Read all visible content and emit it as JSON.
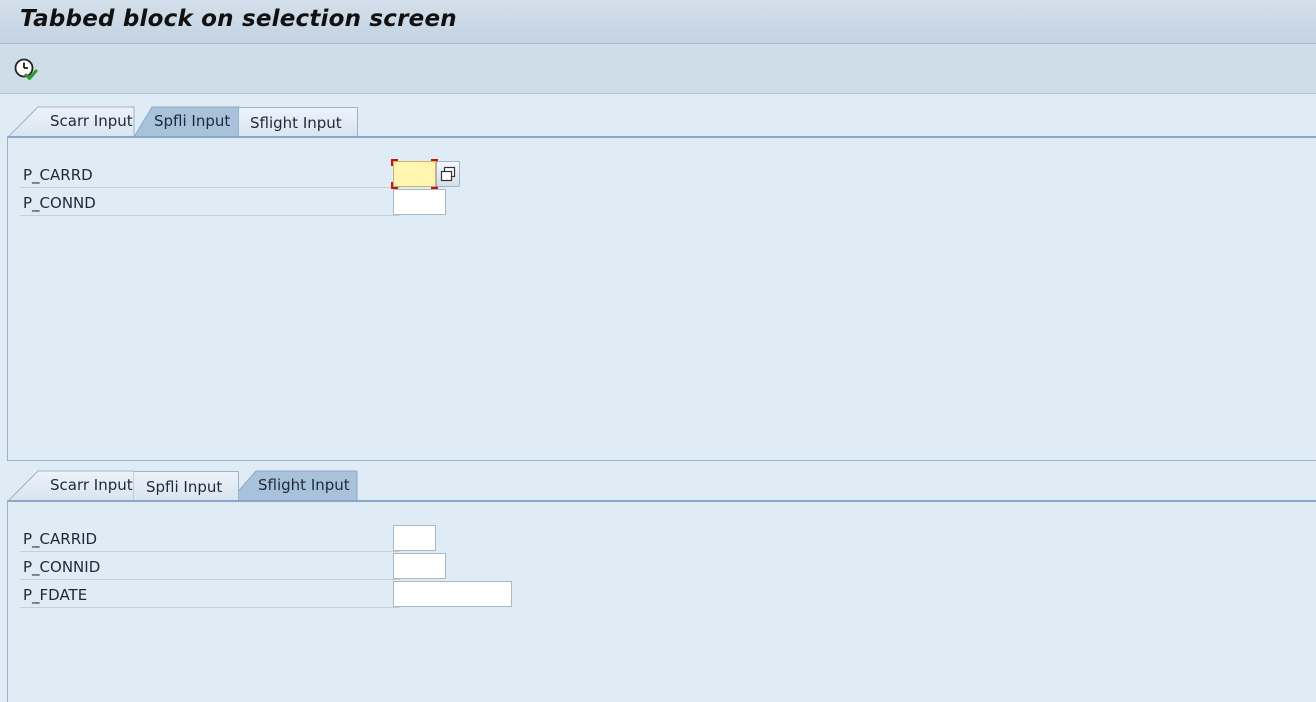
{
  "window": {
    "title": "Tabbed block on selection screen"
  },
  "toolbar": {
    "execute_icon": "execute-clock-check-icon"
  },
  "tabblock1": {
    "tabs": [
      {
        "label": "Scarr Input",
        "active": false
      },
      {
        "label": "Spfli Input",
        "active": true
      },
      {
        "label": "Sflight Input",
        "active": false
      }
    ],
    "fields": [
      {
        "label": "P_CARRD",
        "value": "",
        "focused": true
      },
      {
        "label": "P_CONND",
        "value": ""
      }
    ]
  },
  "tabblock2": {
    "tabs": [
      {
        "label": "Scarr Input",
        "active": false
      },
      {
        "label": "Spfli Input",
        "active": false
      },
      {
        "label": "Sflight Input",
        "active": true
      }
    ],
    "fields": [
      {
        "label": "P_CARRID",
        "value": ""
      },
      {
        "label": "P_CONNID",
        "value": ""
      },
      {
        "label": "P_FDATE",
        "value": ""
      }
    ]
  },
  "colors": {
    "background": "#dfebf5",
    "active_tab": "#a9c2dc",
    "focus_field": "#fff4b0",
    "focus_marker": "#cc1111"
  }
}
